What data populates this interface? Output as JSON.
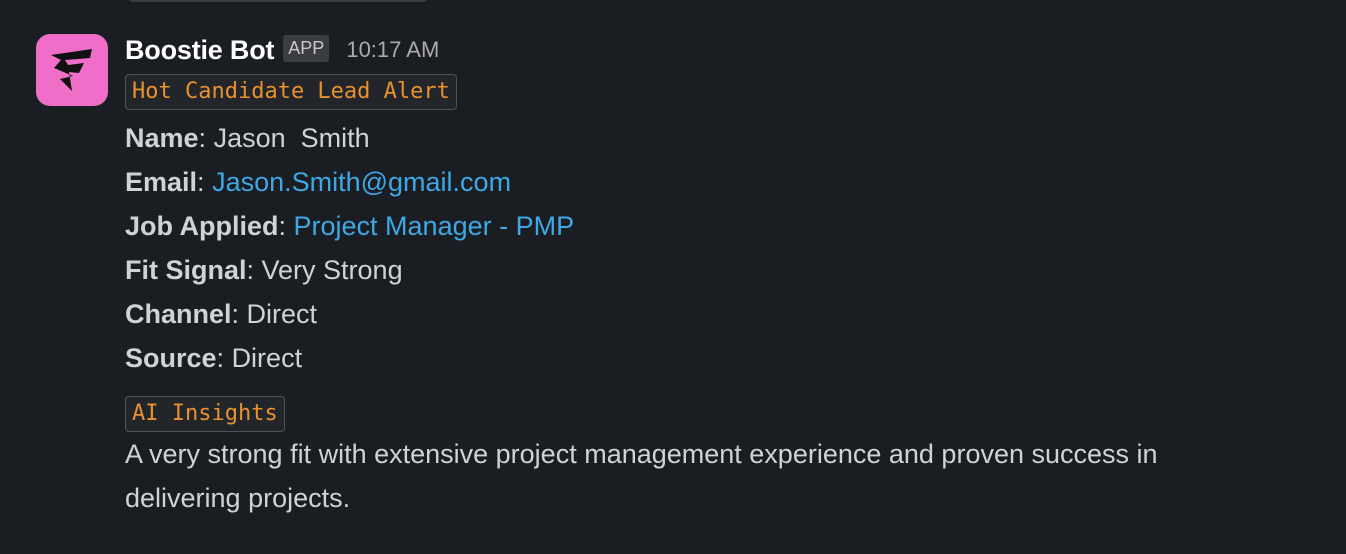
{
  "message": {
    "sender": "Boostie Bot",
    "badge": "APP",
    "timestamp": "10:17 AM",
    "alert_title": "Hot Candidate Lead Alert",
    "fields": [
      {
        "label": "Name",
        "value": "Jason  Smith"
      },
      {
        "label": "Email",
        "value": "Jason.Smith@gmail.com"
      },
      {
        "label": "Job Applied",
        "value": "Project Manager - PMP"
      },
      {
        "label": "Fit Signal",
        "value": "Very Strong"
      },
      {
        "label": "Channel",
        "value": "Direct"
      },
      {
        "label": "Source",
        "value": "Direct"
      }
    ],
    "insights_title": "AI Insights",
    "insights_text": "A very strong fit with extensive project management experience and proven success in delivering projects."
  },
  "colors": {
    "background": "#1a1d21",
    "avatar": "#ef6fc8",
    "link": "#3ea8e5",
    "code_text": "#e8912d"
  },
  "icons": {
    "avatar": "boostie-logo-icon"
  }
}
